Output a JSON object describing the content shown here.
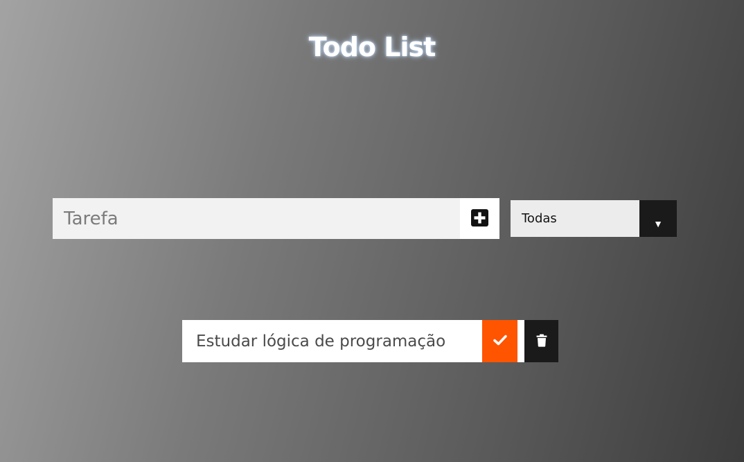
{
  "header": {
    "title": "Todo List"
  },
  "form": {
    "input_placeholder": "Tarefa",
    "input_value": "",
    "add_icon": "plus-square-icon"
  },
  "filter": {
    "selected": "Todas",
    "arrow": "▼"
  },
  "todos": [
    {
      "text": "Estudar lógica de programação",
      "complete_icon": "check-icon",
      "delete_icon": "trash-icon"
    }
  ],
  "colors": {
    "complete_button": "#ff5400",
    "delete_button": "#1a1a1a",
    "title_glow": "#c8e1ff"
  }
}
